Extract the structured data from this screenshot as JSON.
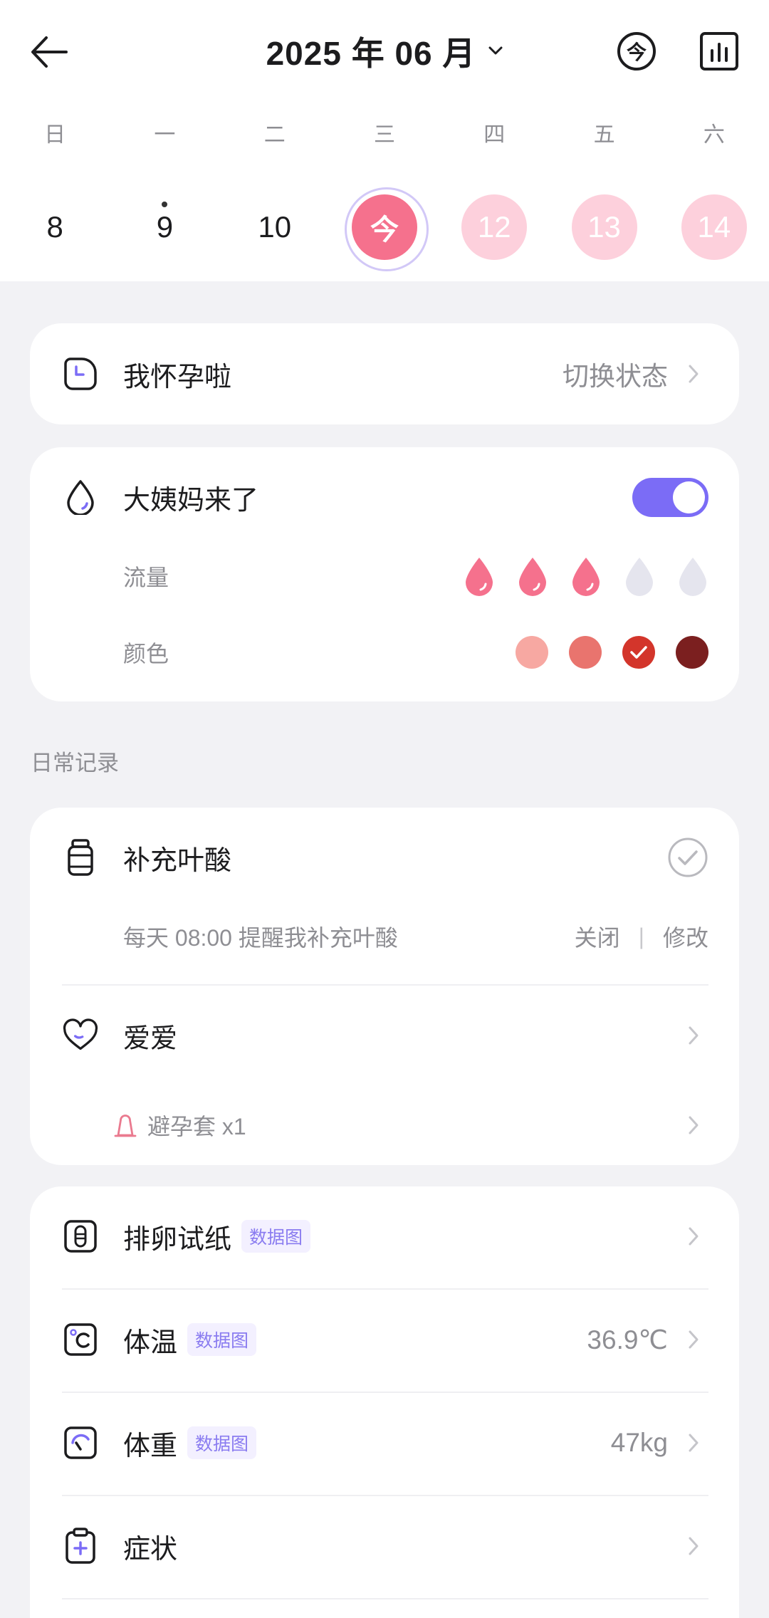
{
  "header": {
    "title": "2025 年 06 月",
    "today_button_label": "今",
    "back_icon": "arrow-left-icon",
    "chart_icon": "bar-chart-icon"
  },
  "week": {
    "weekdays": [
      "日",
      "一",
      "二",
      "三",
      "四",
      "五",
      "六"
    ],
    "dates": [
      {
        "label": "8",
        "is_today": false,
        "predicted": false,
        "marked": false
      },
      {
        "label": "9",
        "is_today": false,
        "predicted": false,
        "marked": true
      },
      {
        "label": "10",
        "is_today": false,
        "predicted": false,
        "marked": false
      },
      {
        "label": "今",
        "is_today": true,
        "predicted": false,
        "marked": false
      },
      {
        "label": "12",
        "is_today": false,
        "predicted": true,
        "marked": false
      },
      {
        "label": "13",
        "is_today": false,
        "predicted": true,
        "marked": false
      },
      {
        "label": "14",
        "is_today": false,
        "predicted": true,
        "marked": false
      }
    ]
  },
  "status_card": {
    "icon": "pregnancy-clock-icon",
    "label": "我怀孕啦",
    "action": "切换状态"
  },
  "period_card": {
    "icon": "drop-icon",
    "title": "大姨妈来了",
    "toggle_on": true,
    "flow": {
      "label": "流量",
      "level": 3,
      "max": 5
    },
    "color": {
      "label": "颜色",
      "options": [
        "#f7a8a2",
        "#e9746e",
        "#d3352b",
        "#7b1f1f"
      ],
      "selected_index": 2
    }
  },
  "section_label": "日常记录",
  "folic_acid": {
    "icon": "bottle-icon",
    "title": "补充叶酸",
    "checked": false,
    "reminder": "每天 08:00 提醒我补充叶酸",
    "off_label": "关闭",
    "separator": "|",
    "edit_label": "修改"
  },
  "intimacy": {
    "icon": "heart-icon",
    "title": "爱爱",
    "detail_icon": "condom-icon",
    "detail": "避孕套 x1"
  },
  "records": [
    {
      "icon": "ovulation-test-icon",
      "title": "排卵试纸",
      "badge": "数据图"
    },
    {
      "icon": "thermometer-icon",
      "title": "体温",
      "badge": "数据图",
      "value": "36.9℃"
    },
    {
      "icon": "scale-icon",
      "title": "体重",
      "badge": "数据图",
      "value": "47kg"
    },
    {
      "icon": "clipboard-plus-icon",
      "title": "症状"
    }
  ],
  "colors": {
    "accent": "#7b6cf6",
    "today": "#f5718d",
    "predicted": "#fdd0dc",
    "flow_filled": "#f5718d",
    "flow_empty": "#e5e5ee",
    "background": "#f2f2f5",
    "text_secondary": "#8e8e93"
  }
}
